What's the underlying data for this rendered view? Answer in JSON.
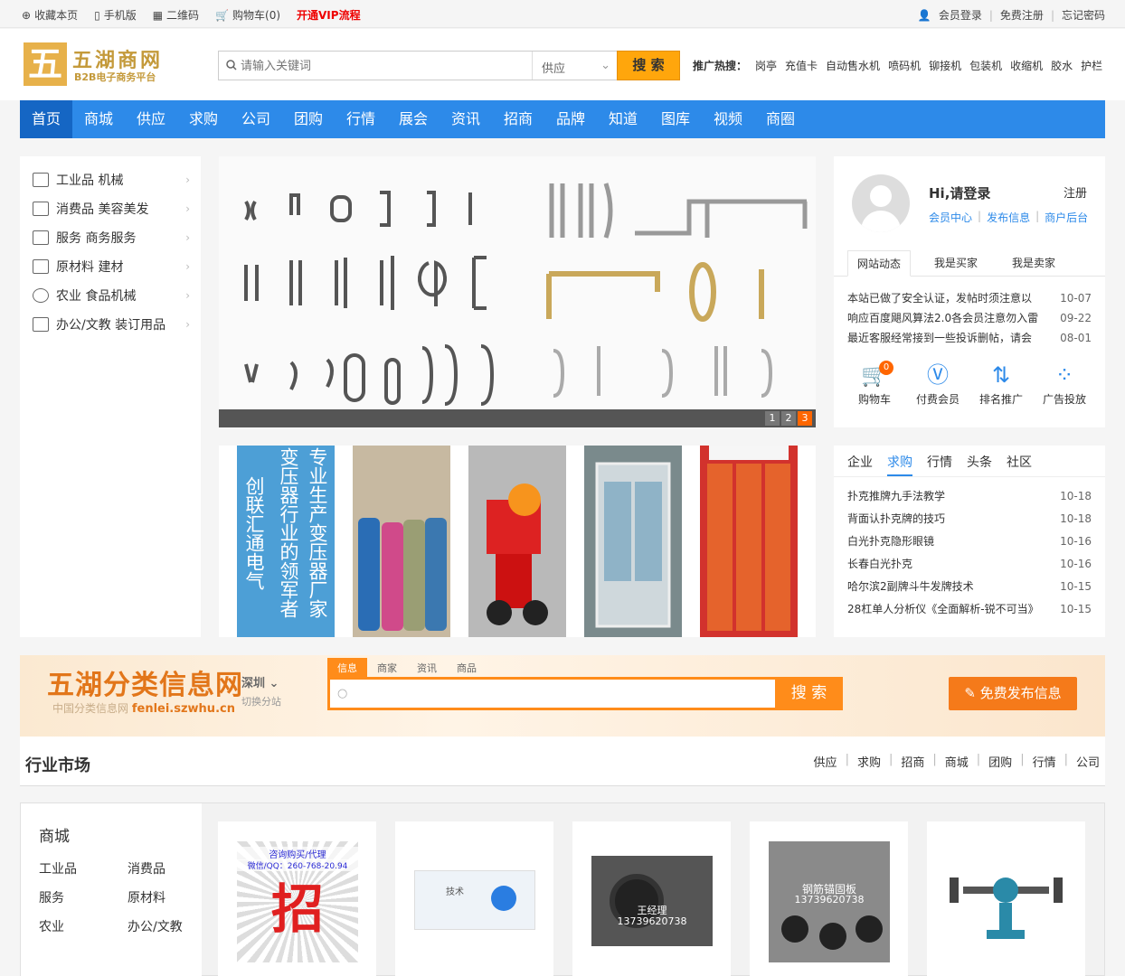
{
  "topbar": {
    "left": [
      "收藏本页",
      "手机版",
      "二维码",
      "购物车(0)"
    ],
    "vip": "开通VIP流程",
    "right": [
      "会员登录",
      "免费注册",
      "忘记密码"
    ]
  },
  "logo": {
    "mark": "五",
    "name": "五湖商网",
    "sub": "B2B电子商务平台"
  },
  "search": {
    "placeholder": "请输入关键词",
    "select": "供应",
    "button": "搜 索"
  },
  "hot": {
    "label": "推广热搜：",
    "items": [
      "岗亭",
      "充值卡",
      "自动售水机",
      "喷码机",
      "铆接机",
      "包装机",
      "收缩机",
      "胶水",
      "护栏"
    ]
  },
  "nav": [
    "首页",
    "商城",
    "供应",
    "求购",
    "公司",
    "团购",
    "行情",
    "展会",
    "资讯",
    "招商",
    "品牌",
    "知道",
    "图库",
    "视频",
    "商圈"
  ],
  "categories": [
    "工业品 机械",
    "消费品 美容美发",
    "服务 商务服务",
    "原材料 建材",
    "农业 食品机械",
    "办公/文教 装订用品"
  ],
  "banner": {
    "pages": [
      "1",
      "2",
      "3"
    ]
  },
  "thumbs": {
    "t1_line1": "专业生产变压器厂家",
    "t1_line2": "变压器行业的领军者",
    "t1_line3": "创联汇通电气"
  },
  "user": {
    "greeting": "Hi,请登录",
    "register": "注册",
    "links": [
      "会员中心",
      "发布信息",
      "商户后台"
    ],
    "tabs": [
      "网站动态",
      "我是买家",
      "我是卖家"
    ],
    "news": [
      {
        "t": "本站已做了安全认证，发帖时须注意以",
        "d": "10-07"
      },
      {
        "t": "响应百度飓风算法2.0各会员注意勿入雷",
        "d": "09-22"
      },
      {
        "t": "最近客服经常接到一些投诉删帖，请会",
        "d": "08-01"
      }
    ],
    "quick": [
      {
        "label": "购物车",
        "badge": "0"
      },
      {
        "label": "付费会员"
      },
      {
        "label": "排名推广"
      },
      {
        "label": "广告投放"
      }
    ]
  },
  "box2": {
    "tabs": [
      "企业",
      "求购",
      "行情",
      "头条",
      "社区"
    ],
    "list": [
      {
        "t": "扑克推牌九手法教学",
        "d": "10-18"
      },
      {
        "t": "背面认扑克牌的技巧",
        "d": "10-18"
      },
      {
        "t": "白光扑克隐形眼镜",
        "d": "10-16"
      },
      {
        "t": "长春白光扑克",
        "d": "10-16"
      },
      {
        "t": "哈尔滨2副牌斗牛发牌技术",
        "d": "10-15"
      },
      {
        "t": "28杠单人分析仪《全面解析-锐不可当》",
        "d": "10-15"
      }
    ]
  },
  "fenlei": {
    "logo": "五湖分类信息网",
    "url_pre": "中国分类信息网",
    "url": "fenlei.szwhu.cn",
    "city": "深圳",
    "switch": "切换分站",
    "tabs": [
      "信息",
      "商家",
      "资讯",
      "商品"
    ],
    "button": "搜 索",
    "publish": "免费发布信息"
  },
  "market": {
    "title": "行业市场",
    "links": [
      "供应",
      "求购",
      "招商",
      "商城",
      "团购",
      "行情",
      "公司"
    ]
  },
  "shop": {
    "title": "商城",
    "cats": [
      "工业品",
      "消费品",
      "服务",
      "原材料",
      "农业",
      "办公/文教"
    ],
    "card1_top": "咨询购买/代理",
    "card1_qq": "微信/QQ：260-768-20.94",
    "card1_big": "招",
    "card2_txt": "技术",
    "card3_txt": "王经理",
    "card3_tel": "13739620738",
    "card4_txt": "钢筋锚固板",
    "card4_tel": "13739620738"
  }
}
